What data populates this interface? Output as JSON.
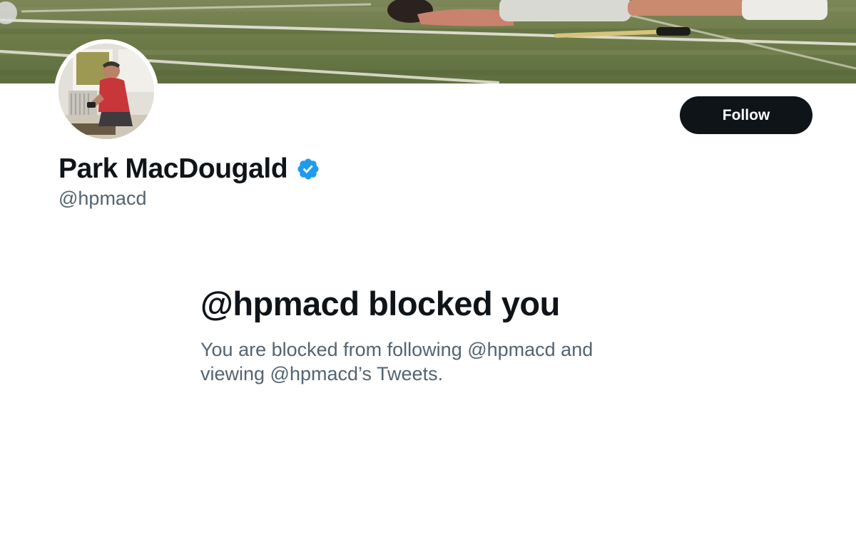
{
  "profile": {
    "display_name": "Park MacDougald",
    "handle": "@hpmacd",
    "verified_icon": "verified-badge-icon",
    "verified_color": "#1d9bf0"
  },
  "actions": {
    "follow_label": "Follow"
  },
  "blocked": {
    "title": "@hpmacd blocked you",
    "line1": "You are blocked from following @hpmacd and",
    "line2": "viewing @hpmacd’s Tweets."
  },
  "colors": {
    "text_primary": "#0f1419",
    "text_secondary": "#536471",
    "button_bg": "#0f1419"
  }
}
